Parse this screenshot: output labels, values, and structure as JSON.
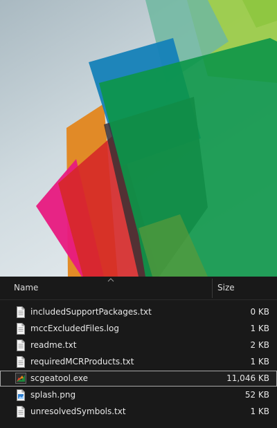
{
  "columns": {
    "name": "Name",
    "size": "Size"
  },
  "files": [
    {
      "name": "includedSupportPackages.txt",
      "size": "0 KB",
      "icon": "text-file-icon",
      "selected": false
    },
    {
      "name": "mccExcludedFiles.log",
      "size": "1 KB",
      "icon": "text-file-icon",
      "selected": false
    },
    {
      "name": "readme.txt",
      "size": "2 KB",
      "icon": "text-file-icon",
      "selected": false
    },
    {
      "name": "requiredMCRProducts.txt",
      "size": "1 KB",
      "icon": "text-file-icon",
      "selected": false
    },
    {
      "name": "scgeatool.exe",
      "size": "11,046 KB",
      "icon": "matlab-app-icon",
      "selected": true
    },
    {
      "name": "splash.png",
      "size": "52 KB",
      "icon": "image-file-icon",
      "selected": false
    },
    {
      "name": "unresolvedSymbols.txt",
      "size": "1 KB",
      "icon": "text-file-icon",
      "selected": false
    }
  ],
  "colors": {
    "background": "#191919",
    "text": "#e8e8e8",
    "selection_border": "#a9a9a9"
  }
}
